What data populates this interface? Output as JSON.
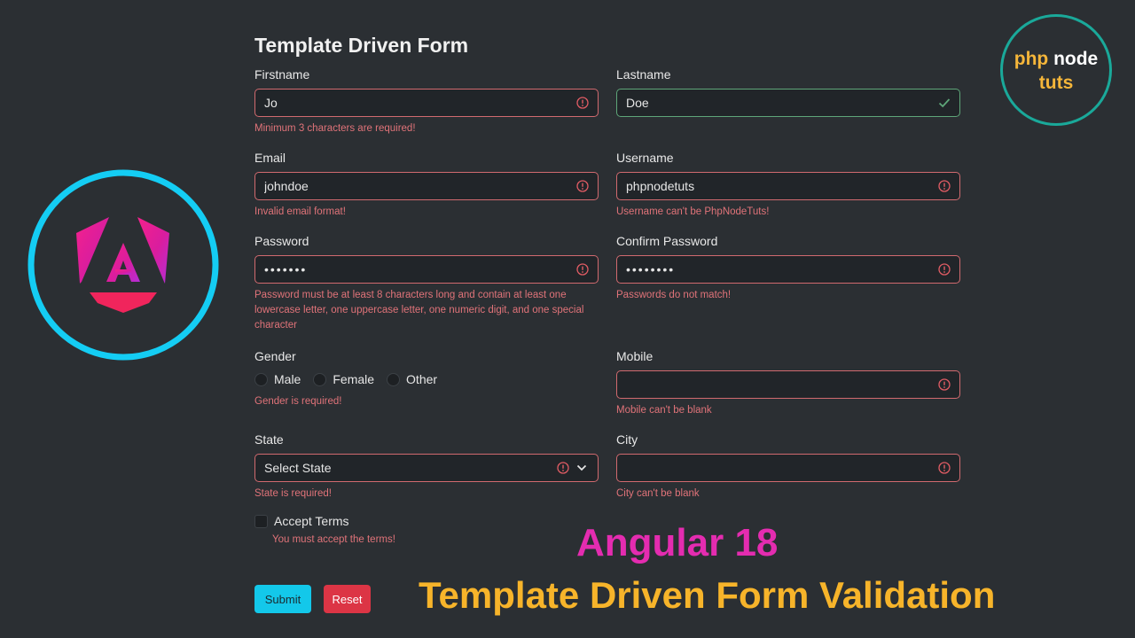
{
  "form": {
    "title": "Template Driven Form",
    "firstname": {
      "label": "Firstname",
      "value": "Jo",
      "error": "Minimum 3 characters are required!"
    },
    "lastname": {
      "label": "Lastname",
      "value": "Doe"
    },
    "email": {
      "label": "Email",
      "value": "johndoe",
      "error": "Invalid email format!"
    },
    "username": {
      "label": "Username",
      "value": "phpnodetuts",
      "error": "Username can't be PhpNodeTuts!"
    },
    "password": {
      "label": "Password",
      "value": "•••••••",
      "error": "Password must be at least 8 characters long and contain at least one lowercase letter, one uppercase letter, one numeric digit, and one special character"
    },
    "confirm_password": {
      "label": "Confirm Password",
      "value": "••••••••",
      "error": "Passwords do not match!"
    },
    "gender": {
      "label": "Gender",
      "options": [
        "Male",
        "Female",
        "Other"
      ],
      "error": "Gender is required!"
    },
    "mobile": {
      "label": "Mobile",
      "value": "",
      "error": "Mobile can't be blank"
    },
    "state": {
      "label": "State",
      "selected": "Select State",
      "error": "State is required!"
    },
    "city": {
      "label": "City",
      "value": "",
      "error": "City can't be blank"
    },
    "terms": {
      "label": "Accept Terms",
      "error": "You must accept the terms!"
    },
    "submit_label": "Submit",
    "reset_label": "Reset"
  },
  "badge": {
    "line1a": "php",
    "line1b": "node",
    "line2": "tuts"
  },
  "promo": {
    "line1": "Angular 18",
    "line2": "Template Driven Form Validation"
  },
  "colors": {
    "background": "#2b2f33",
    "error": "#e07379",
    "valid": "#5ea679",
    "submit": "#13c8ea",
    "reset": "#dc3545",
    "angular_ring": "#14cdf4",
    "promo_pink": "#e42cb0",
    "promo_gold": "#f7b42a"
  },
  "icons": {
    "error": "exclamation-circle-icon",
    "valid": "check-icon",
    "dropdown": "chevron-down-icon",
    "logo": "angular-logo-icon"
  }
}
